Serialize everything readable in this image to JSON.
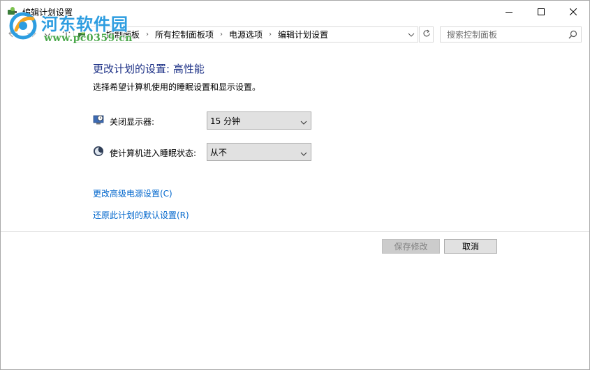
{
  "window": {
    "title": "编辑计划设置",
    "controls": {
      "minimize": "minimize-icon",
      "maximize": "maximize-icon",
      "close": "close-icon"
    }
  },
  "watermark": {
    "site_name": "河东软件园",
    "url": "www.pc0359.cn"
  },
  "navigation": {
    "breadcrumbs": [
      "控制面板",
      "所有控制面板项",
      "电源选项",
      "编辑计划设置"
    ],
    "search": {
      "placeholder": "搜索控制面板",
      "value": ""
    }
  },
  "content": {
    "heading": "更改计划的设置: 高性能",
    "subheading": "选择希望计算机使用的睡眠设置和显示设置。",
    "settings": [
      {
        "label": "关闭显示器:",
        "value": "15 分钟",
        "icon": "monitor-icon"
      },
      {
        "label": "使计算机进入睡眠状态:",
        "value": "从不",
        "icon": "moon-sleep-icon"
      }
    ],
    "links": {
      "advanced": "更改高级电源设置(C)",
      "restore": "还原此计划的默认设置(R)"
    }
  },
  "buttons": {
    "save": {
      "label": "保存修改",
      "enabled": false
    },
    "cancel": {
      "label": "取消",
      "enabled": true
    }
  },
  "colors": {
    "heading": "#1e3287",
    "link": "#0066cc",
    "watermark_name": "#2d9de0",
    "watermark_url": "#4aa84a"
  }
}
